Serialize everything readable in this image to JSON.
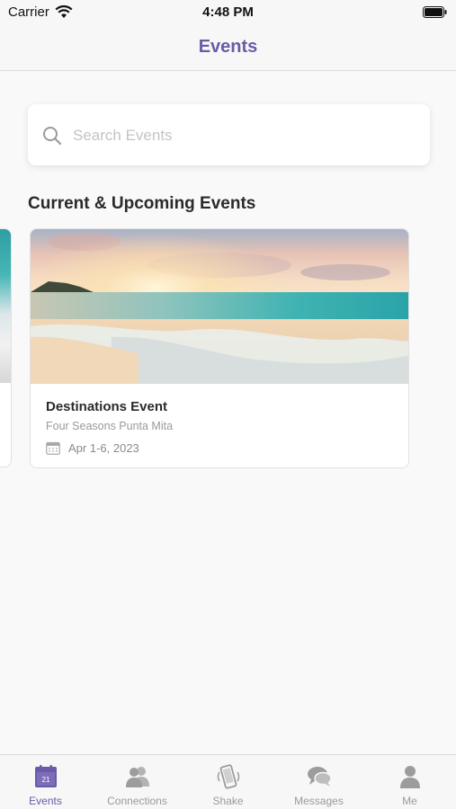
{
  "status_bar": {
    "carrier": "Carrier",
    "time": "4:48 PM"
  },
  "nav": {
    "title": "Events"
  },
  "search": {
    "placeholder": "Search Events"
  },
  "section": {
    "title": "Current & Upcoming Events"
  },
  "events": [
    {
      "title": "Destinations Event",
      "venue": "Four Seasons Punta Mita",
      "dates": "Apr 1-6, 2023"
    }
  ],
  "tabs": [
    {
      "label": "Events",
      "icon": "calendar-icon",
      "badge": "21",
      "active": true
    },
    {
      "label": "Connections",
      "icon": "connections-icon",
      "active": false
    },
    {
      "label": "Shake",
      "icon": "shake-phone-icon",
      "active": false
    },
    {
      "label": "Messages",
      "icon": "messages-icon",
      "active": false
    },
    {
      "label": "Me",
      "icon": "person-icon",
      "active": false
    }
  ],
  "colors": {
    "accent": "#6b5aa8",
    "inactive": "#9a9a9a",
    "background": "#f9f9f9"
  }
}
